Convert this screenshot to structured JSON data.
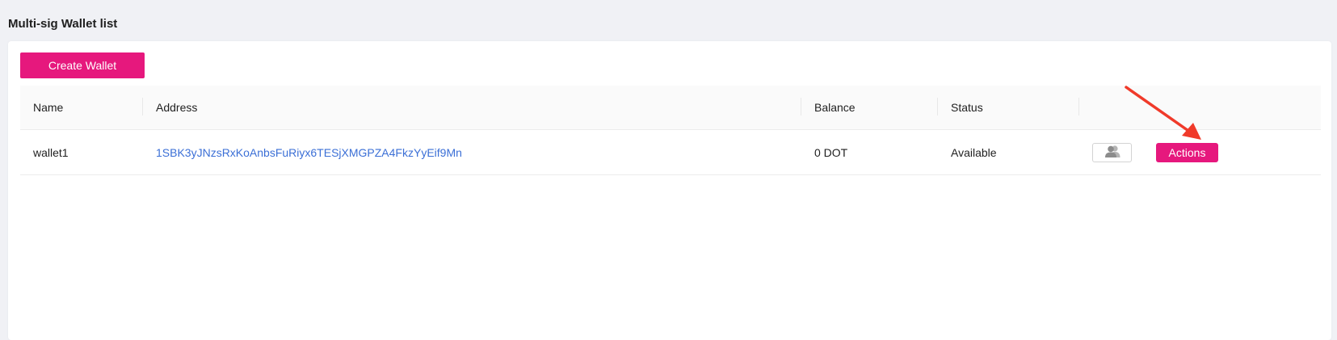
{
  "page": {
    "title": "Multi-sig Wallet list"
  },
  "toolbar": {
    "create_label": "Create Wallet"
  },
  "table": {
    "columns": [
      "Name",
      "Address",
      "Balance",
      "Status"
    ],
    "rows": [
      {
        "name": "wallet1",
        "address": "1SBK3yJNzsRxKoAnbsFuRiyx6TESjXMGPZA4FkzYyEif9Mn",
        "balance": "0 DOT",
        "status": "Available",
        "action_label": "Actions"
      }
    ]
  },
  "icons": {
    "members": "users-icon"
  },
  "colors": {
    "accent": "#e6187d",
    "link": "#3b6fd6",
    "annotation_arrow": "#f03a2a"
  }
}
